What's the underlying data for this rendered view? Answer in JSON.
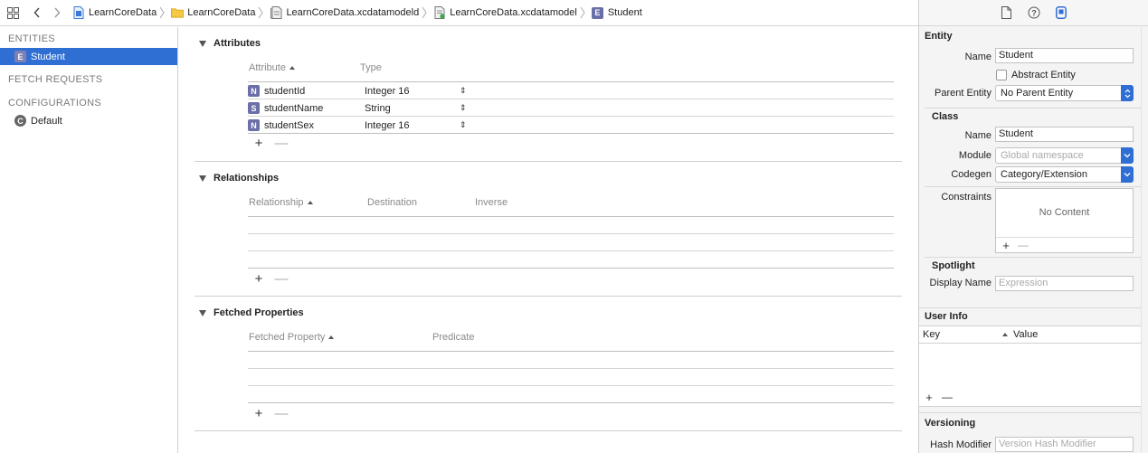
{
  "breadcrumbs": [
    {
      "label": "LearnCoreData",
      "icon": "project-file-icon"
    },
    {
      "label": "LearnCoreData",
      "icon": "folder-icon"
    },
    {
      "label": "LearnCoreData.xcdatamodeld",
      "icon": "datamodel-bundle-icon"
    },
    {
      "label": "LearnCoreData.xcdatamodel",
      "icon": "datamodel-file-icon"
    },
    {
      "label": "Student",
      "icon": "entity-icon",
      "badge": "E"
    }
  ],
  "sidebar": {
    "entities_header": "ENTITIES",
    "entities": [
      {
        "label": "Student",
        "badge": "E",
        "selected": true
      }
    ],
    "fetch_requests_header": "FETCH REQUESTS",
    "configurations_header": "CONFIGURATIONS",
    "configurations": [
      {
        "label": "Default",
        "badge": "C"
      }
    ]
  },
  "attributes": {
    "title": "Attributes",
    "col_attribute": "Attribute",
    "col_type": "Type",
    "rows": [
      {
        "badge": "N",
        "name": "studentId",
        "type": "Integer 16"
      },
      {
        "badge": "S",
        "name": "studentName",
        "type": "String"
      },
      {
        "badge": "N",
        "name": "studentSex",
        "type": "Integer 16"
      }
    ]
  },
  "relationships": {
    "title": "Relationships",
    "col_relationship": "Relationship",
    "col_destination": "Destination",
    "col_inverse": "Inverse"
  },
  "fetched": {
    "title": "Fetched Properties",
    "col_property": "Fetched Property",
    "col_predicate": "Predicate"
  },
  "controls": {
    "plus": "+",
    "minus": "—"
  },
  "inspector": {
    "entity_header": "Entity",
    "name_label": "Name",
    "name_value": "Student",
    "abstract_label": "Abstract Entity",
    "parent_label": "Parent Entity",
    "parent_value": "No Parent Entity",
    "class_header": "Class",
    "class_name_label": "Name",
    "class_name_value": "Student",
    "module_label": "Module",
    "module_placeholder": "Global namespace",
    "codegen_label": "Codegen",
    "codegen_value": "Category/Extension",
    "constraints_label": "Constraints",
    "constraints_empty": "No Content",
    "spotlight_header": "Spotlight",
    "display_name_label": "Display Name",
    "display_name_placeholder": "Expression",
    "userinfo_header": "User Info",
    "key_col": "Key",
    "value_col": "Value",
    "versioning_header": "Versioning",
    "hash_label": "Hash Modifier",
    "hash_placeholder": "Version Hash Modifier"
  },
  "colors": {
    "selection": "#2f6fd3",
    "badge": "#6b6fa8"
  }
}
